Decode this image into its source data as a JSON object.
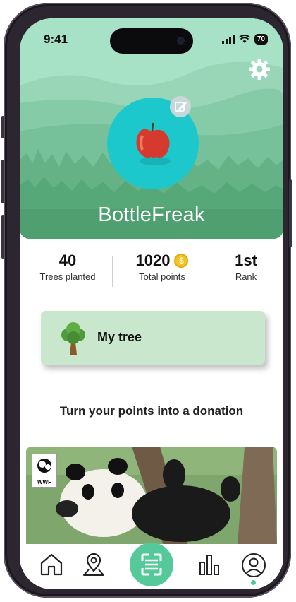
{
  "status_bar": {
    "time": "9:41",
    "battery": "70"
  },
  "profile": {
    "username": "BottleFreak"
  },
  "stats": [
    {
      "value": "40",
      "label": "Trees planted"
    },
    {
      "value": "1020",
      "label": "Total points",
      "coin_symbol": "$"
    },
    {
      "value": "1st",
      "label": "Rank"
    }
  ],
  "my_tree": {
    "label": "My tree"
  },
  "donation": {
    "title": "Turn your points into a donation",
    "partner_logo_text": "WWF"
  },
  "nav": {
    "items": [
      {
        "icon": "home-icon"
      },
      {
        "icon": "map-pin-icon"
      },
      {
        "icon": "scan-icon"
      },
      {
        "icon": "bar-chart-icon"
      },
      {
        "icon": "profile-icon"
      }
    ],
    "active": "profile"
  },
  "colors": {
    "accent": "#56c99a",
    "header": "#a6e0c4",
    "avatar_bg": "#1dc8cc",
    "card": "#c9e7cc"
  }
}
